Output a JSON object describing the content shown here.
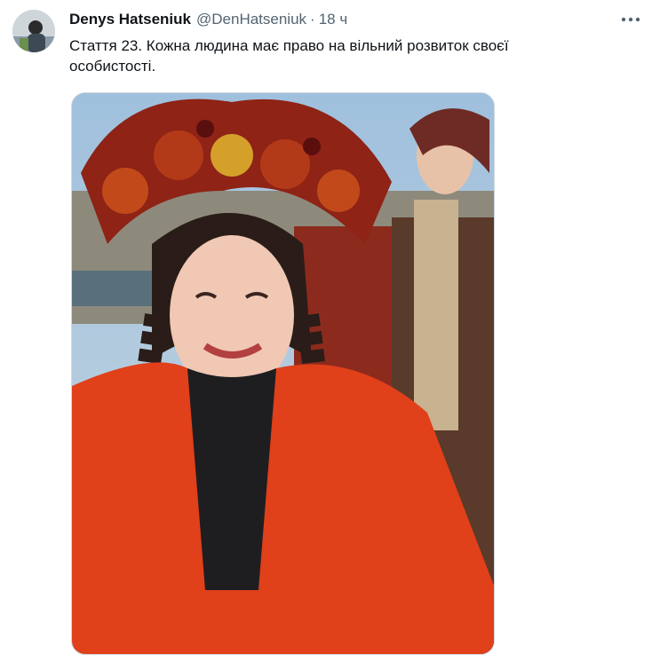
{
  "tweet": {
    "author_name": "Denys Hatseniuk",
    "author_handle": "@DenHatseniuk",
    "separator": "·",
    "time": "18 ч",
    "text": "Стаття 23. Кожна людина має право на вільний розвиток своєї особистості."
  },
  "icons": {
    "more": "more-horizontal-icon"
  },
  "colors": {
    "text_primary": "#0f1419",
    "text_secondary": "#536471",
    "coat_red": "#e0401a"
  }
}
